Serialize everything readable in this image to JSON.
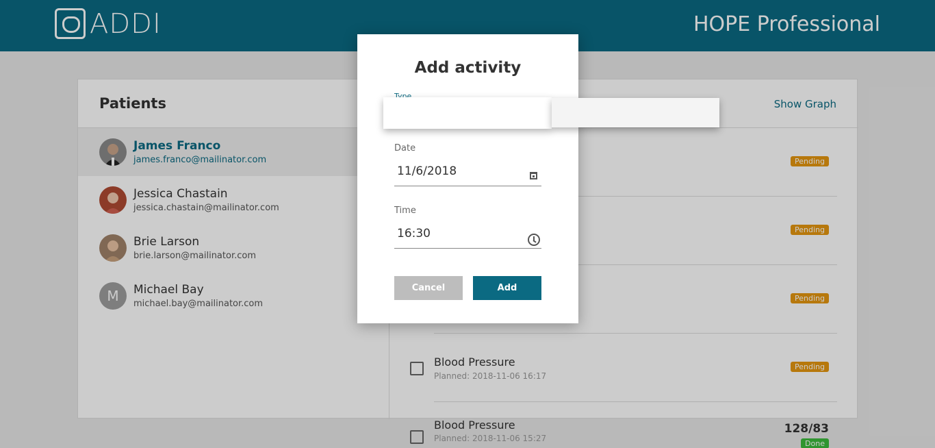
{
  "header": {
    "logo_text": "ADDI",
    "brand": "HOPE Professional"
  },
  "panel": {
    "title": "Patients",
    "show_graph": "Show Graph"
  },
  "patients": [
    {
      "name": "James Franco",
      "email": "james.franco@mailinator.com"
    },
    {
      "name": "Jessica Chastain",
      "email": "jessica.chastain@mailinator.com"
    },
    {
      "name": "Brie Larson",
      "email": "brie.larson@mailinator.com"
    },
    {
      "name": "Michael Bay",
      "email": "michael.bay@mailinator.com",
      "initial": "M"
    }
  ],
  "activities": [
    {
      "badge": "Pending"
    },
    {
      "badge": "Pending"
    },
    {
      "badge": "Pending"
    },
    {
      "title": "Blood Pressure",
      "planned": "Planned: 2018-11-06 16:17",
      "badge": "Pending"
    },
    {
      "title": "Blood Pressure",
      "planned": "Planned: 2018-11-06 15:27",
      "reading": "128/83",
      "badge": "Done"
    }
  ],
  "modal": {
    "title": "Add activity",
    "type_label": "Type",
    "date_label": "Date",
    "date_value": "11/6/2018",
    "time_label": "Time",
    "time_value": "16:30",
    "cancel": "Cancel",
    "add": "Add"
  },
  "colors": {
    "primary": "#0b6a82",
    "pending": "#e5960f",
    "done": "#3dbb3d"
  }
}
